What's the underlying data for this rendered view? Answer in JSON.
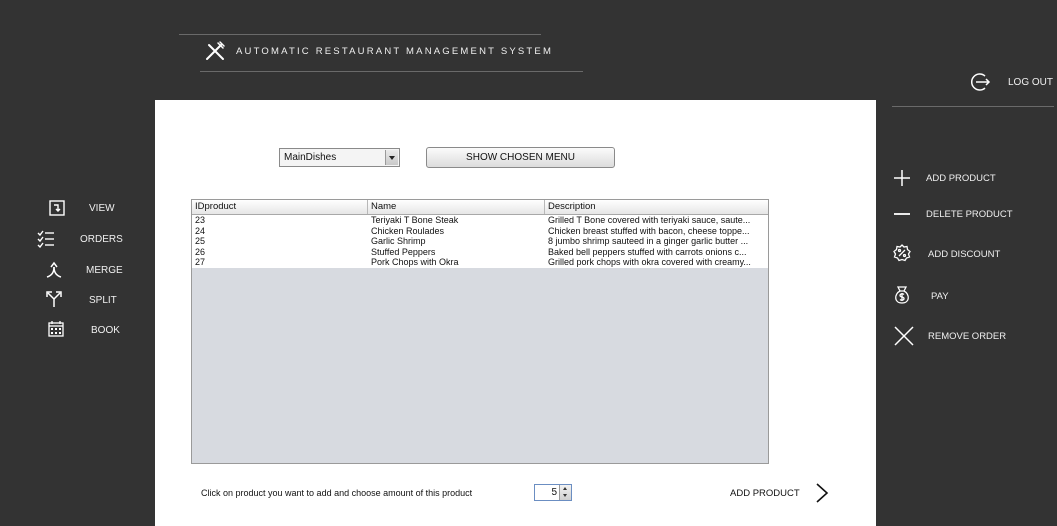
{
  "header": {
    "title": "AUTOMATIC RESTAURANT MANAGEMENT SYSTEM",
    "logout_label": "LOG OUT"
  },
  "nav": [
    {
      "label": "VIEW",
      "icon": "view-icon"
    },
    {
      "label": "ORDERS",
      "icon": "orders-icon"
    },
    {
      "label": "MERGE",
      "icon": "merge-icon"
    },
    {
      "label": "SPLIT",
      "icon": "split-icon"
    },
    {
      "label": "BOOK",
      "icon": "calendar-icon"
    }
  ],
  "actions": [
    {
      "label": "ADD PRODUCT",
      "icon": "plus-icon"
    },
    {
      "label": "DELETE PRODUCT",
      "icon": "minus-icon"
    },
    {
      "label": "ADD DISCOUNT",
      "icon": "discount-icon"
    },
    {
      "label": "PAY",
      "icon": "money-bag-icon"
    },
    {
      "label": "REMOVE ORDER",
      "icon": "close-icon"
    }
  ],
  "menu": {
    "selected": "MainDishes",
    "show_button": "SHOW CHOSEN MENU"
  },
  "table": {
    "columns": [
      "IDproduct",
      "Name",
      "Description"
    ],
    "rows": [
      [
        "23",
        "Teriyaki T Bone Steak",
        "Grilled T Bone covered with teriyaki sauce, saute..."
      ],
      [
        "24",
        "Chicken Roulades",
        "Chicken breast stuffed with bacon, cheese toppe..."
      ],
      [
        "25",
        "Garlic Shrimp",
        "8 jumbo shrimp sauteed in a ginger garlic butter ..."
      ],
      [
        "26",
        "Stuffed Peppers",
        "Baked bell peppers stuffed with carrots onions c..."
      ],
      [
        "27",
        "Pork Chops with Okra",
        "Grilled pork chops with okra covered with creamy..."
      ]
    ]
  },
  "footer": {
    "hint": "Click on product you want to add and choose amount of this product",
    "quantity": "5",
    "add_button": "ADD PRODUCT"
  }
}
